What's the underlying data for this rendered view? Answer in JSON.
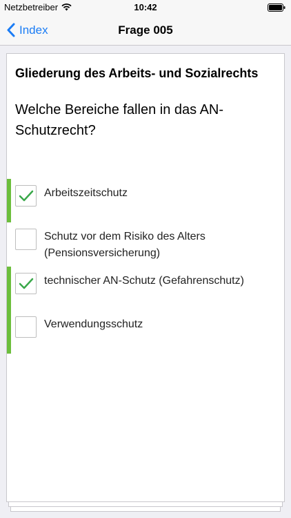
{
  "status_bar": {
    "carrier": "Netzbetreiber",
    "time": "10:42"
  },
  "nav": {
    "back_label": "Index",
    "title": "Frage 005"
  },
  "card": {
    "topic": "Gliederung des Arbeits- und Sozialrechts",
    "question": "Welche Bereiche fallen in das AN-Schutzrecht?",
    "answers": [
      {
        "label": "Arbeitszeitschutz",
        "checked": true,
        "correct": true
      },
      {
        "label": "Schutz vor dem Risiko des Alters (Pensionsversicherung)",
        "checked": false,
        "correct": false
      },
      {
        "label": "technischer AN-Schutz (Gefahrenschutz)",
        "checked": true,
        "correct": true
      },
      {
        "label": "Verwendungsschutz",
        "checked": false,
        "correct": true
      }
    ]
  },
  "colors": {
    "accent": "#1a7cf5",
    "correct_bar": "#6cbe3c",
    "checkmark": "#3aa84a"
  },
  "icons": [
    "wifi-icon",
    "battery-icon",
    "chevron-left-icon",
    "checkmark-icon"
  ]
}
